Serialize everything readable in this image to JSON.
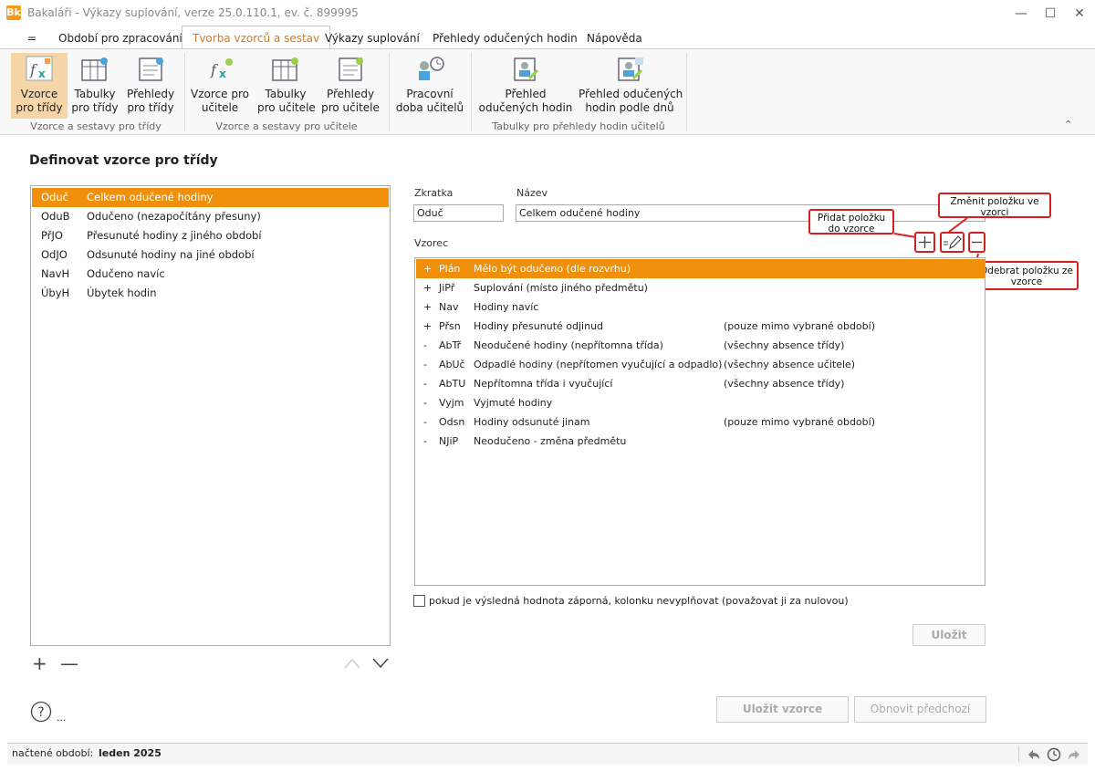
{
  "window": {
    "title": "Bakaláři - Výkazy suplování, verze 25.0.110.1, ev. č. 899995",
    "app_icon": "Bk"
  },
  "menu": {
    "hamburger": "=",
    "items": [
      "Období pro zpracování",
      "Tvorba vzorců a sestav",
      "Výkazy suplování",
      "Přehledy odučených hodin",
      "Nápověda"
    ]
  },
  "ribbon": {
    "buttons": [
      {
        "label1": "Vzorce",
        "label2": "pro třídy"
      },
      {
        "label1": "Tabulky",
        "label2": "pro třídy"
      },
      {
        "label1": "Přehledy",
        "label2": "pro třídy"
      },
      {
        "label1": "Vzorce pro",
        "label2": "učitele"
      },
      {
        "label1": "Tabulky",
        "label2": "pro učitele"
      },
      {
        "label1": "Přehledy",
        "label2": "pro učitele"
      },
      {
        "label1": "Pracovní",
        "label2": "doba učitelů"
      },
      {
        "label1": "Přehled",
        "label2": "odučených hodin"
      },
      {
        "label1": "Přehled odučených",
        "label2": "hodin podle dnů"
      }
    ],
    "groups": [
      "Vzorce a sestavy pro třídy",
      "Vzorce a sestavy pro učitele",
      "Tabulky pro přehledy hodin učitelů"
    ]
  },
  "page": {
    "title": "Definovat vzorce pro třídy"
  },
  "class_list": [
    {
      "abbr": "Oduč",
      "name": "Celkem odučené hodiny"
    },
    {
      "abbr": "OduB",
      "name": "Odučeno (nezapočítány přesuny)"
    },
    {
      "abbr": "PřJO",
      "name": "Přesunuté hodiny z jiného období"
    },
    {
      "abbr": "OdJO",
      "name": "Odsunuté hodiny na jiné období"
    },
    {
      "abbr": "NavH",
      "name": "Odučeno navíc"
    },
    {
      "abbr": "ÚbyH",
      "name": "Úbytek hodin"
    }
  ],
  "form": {
    "abbr_label": "Zkratka",
    "abbr_value": "Oduč",
    "name_label": "Název",
    "name_value": "Celkem odučené hodiny",
    "formula_label": "Vzorec"
  },
  "formula": [
    {
      "sign": "+",
      "abbr": "Plán",
      "name": "Mělo být odučeno (dle rozvrhu)",
      "note": ""
    },
    {
      "sign": "+",
      "abbr": "JiPř",
      "name": "Suplování (místo jiného předmětu)",
      "note": ""
    },
    {
      "sign": "+",
      "abbr": "Nav",
      "name": "Hodiny navíc",
      "note": ""
    },
    {
      "sign": "+",
      "abbr": "Přsn",
      "name": "Hodiny přesunuté odjinud",
      "note": "(pouze mimo vybrané období)"
    },
    {
      "sign": "-",
      "abbr": "AbTř",
      "name": "Neodučené hodiny (nepřítomna třída)",
      "note": "(všechny absence třídy)"
    },
    {
      "sign": "-",
      "abbr": "AbUč",
      "name": "Odpadlé hodiny (nepřítomen vyučující a odpadlo)",
      "note": "(všechny absence učitele)"
    },
    {
      "sign": "-",
      "abbr": "AbTU",
      "name": "Nepřítomna třída i vyučující",
      "note": "(všechny absence třídy)"
    },
    {
      "sign": "-",
      "abbr": "Vyjm",
      "name": "Vyjmuté hodiny",
      "note": ""
    },
    {
      "sign": "-",
      "abbr": "Odsn",
      "name": "Hodiny odsunuté jinam",
      "note": "(pouze mimo vybrané období)"
    },
    {
      "sign": "-",
      "abbr": "NJiP",
      "name": "Neodučeno - změna předmětu",
      "note": ""
    }
  ],
  "callouts": {
    "add": "Přidat položku do vzorce",
    "edit": "Změnit položku ve vzorci",
    "remove": "Odebrat položku ze vzorce"
  },
  "checkbox": {
    "label": "pokud je výsledná hodnota záporná, kolonku nevyplňovat (považovat ji za nulovou)",
    "checked": false
  },
  "buttons": {
    "save": "Uložit",
    "save_formula": "Uložit vzorce",
    "restore": "Obnovit předchozí",
    "more": "..."
  },
  "status": {
    "label": "načtené období:",
    "value": "leden 2025"
  },
  "colors": {
    "accent": "#f0900a",
    "callout": "#d32020"
  }
}
